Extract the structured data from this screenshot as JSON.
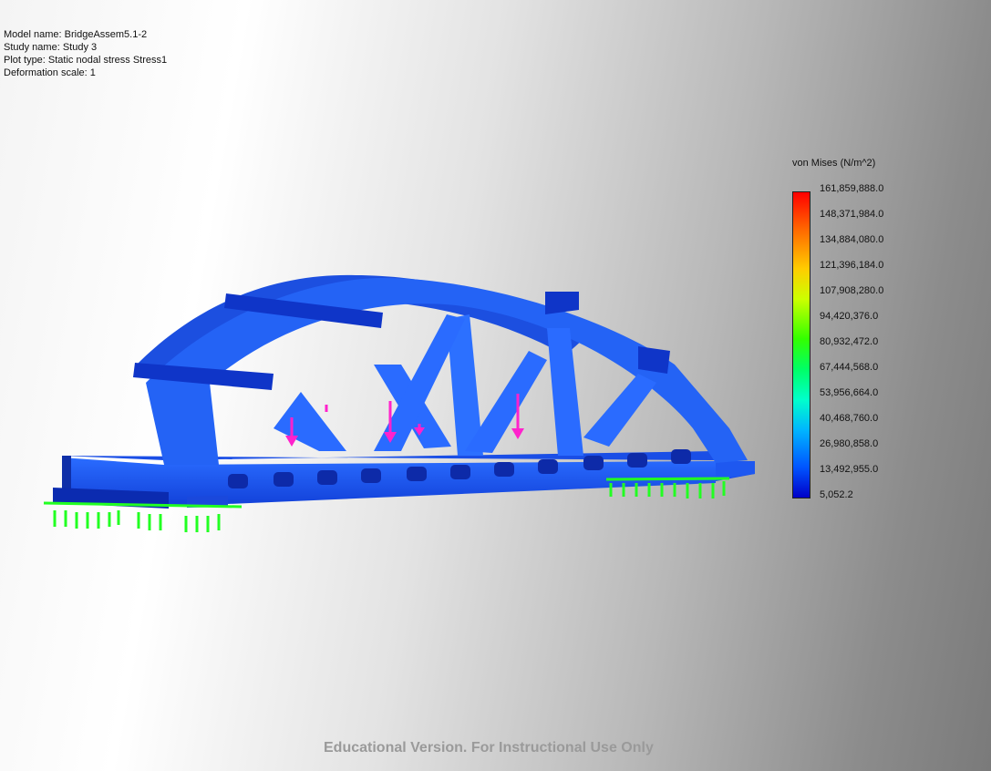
{
  "info": {
    "model_name": "Model name: BridgeAssem5.1-2",
    "study_name": "Study name: Study 3",
    "plot_type": "Plot type: Static nodal stress Stress1",
    "deformation_scale": "Deformation scale: 1"
  },
  "legend": {
    "title": "von Mises (N/m^2)",
    "labels": [
      "161,859,888.0",
      "148,371,984.0",
      "134,884,080.0",
      "121,396,184.0",
      "107,908,280.0",
      "94,420,376.0",
      "80,932,472.0",
      "67,444,568.0",
      "53,956,664.0",
      "40,468,760.0",
      "26,980,858.0",
      "13,492,955.0",
      "5,052.2"
    ],
    "max_color": "#ff0000",
    "min_color": "#0000c8"
  },
  "watermark": "Educational Version. For Instructional Use Only",
  "colors": {
    "bridge": "#1e5ef0",
    "bridge_dark": "#0f2fb4",
    "fixture": "#22ff22",
    "load": "#ff22cc"
  },
  "icons": {
    "fixtures": "fixed-support-icon",
    "loads": "downward-force-arrow-icon"
  }
}
